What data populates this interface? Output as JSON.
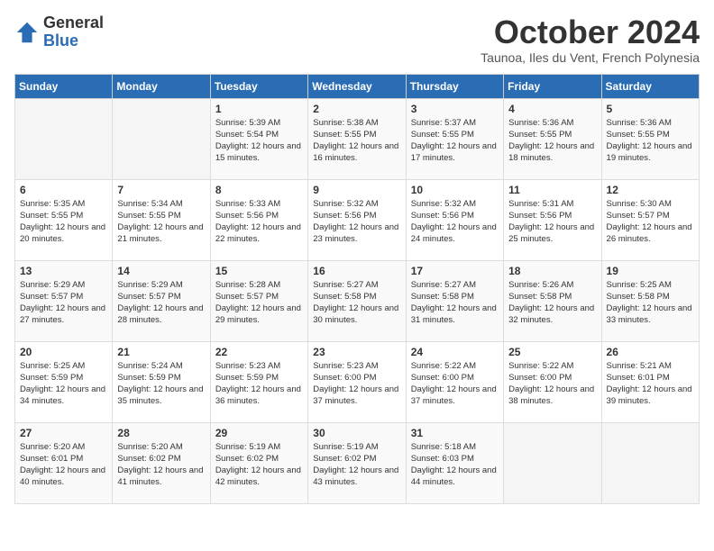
{
  "logo": {
    "general": "General",
    "blue": "Blue"
  },
  "header": {
    "month": "October 2024",
    "location": "Taunoa, Iles du Vent, French Polynesia"
  },
  "weekdays": [
    "Sunday",
    "Monday",
    "Tuesday",
    "Wednesday",
    "Thursday",
    "Friday",
    "Saturday"
  ],
  "weeks": [
    [
      {
        "day": "",
        "sunrise": "",
        "sunset": "",
        "daylight": ""
      },
      {
        "day": "",
        "sunrise": "",
        "sunset": "",
        "daylight": ""
      },
      {
        "day": "1",
        "sunrise": "Sunrise: 5:39 AM",
        "sunset": "Sunset: 5:54 PM",
        "daylight": "Daylight: 12 hours and 15 minutes."
      },
      {
        "day": "2",
        "sunrise": "Sunrise: 5:38 AM",
        "sunset": "Sunset: 5:55 PM",
        "daylight": "Daylight: 12 hours and 16 minutes."
      },
      {
        "day": "3",
        "sunrise": "Sunrise: 5:37 AM",
        "sunset": "Sunset: 5:55 PM",
        "daylight": "Daylight: 12 hours and 17 minutes."
      },
      {
        "day": "4",
        "sunrise": "Sunrise: 5:36 AM",
        "sunset": "Sunset: 5:55 PM",
        "daylight": "Daylight: 12 hours and 18 minutes."
      },
      {
        "day": "5",
        "sunrise": "Sunrise: 5:36 AM",
        "sunset": "Sunset: 5:55 PM",
        "daylight": "Daylight: 12 hours and 19 minutes."
      }
    ],
    [
      {
        "day": "6",
        "sunrise": "Sunrise: 5:35 AM",
        "sunset": "Sunset: 5:55 PM",
        "daylight": "Daylight: 12 hours and 20 minutes."
      },
      {
        "day": "7",
        "sunrise": "Sunrise: 5:34 AM",
        "sunset": "Sunset: 5:55 PM",
        "daylight": "Daylight: 12 hours and 21 minutes."
      },
      {
        "day": "8",
        "sunrise": "Sunrise: 5:33 AM",
        "sunset": "Sunset: 5:56 PM",
        "daylight": "Daylight: 12 hours and 22 minutes."
      },
      {
        "day": "9",
        "sunrise": "Sunrise: 5:32 AM",
        "sunset": "Sunset: 5:56 PM",
        "daylight": "Daylight: 12 hours and 23 minutes."
      },
      {
        "day": "10",
        "sunrise": "Sunrise: 5:32 AM",
        "sunset": "Sunset: 5:56 PM",
        "daylight": "Daylight: 12 hours and 24 minutes."
      },
      {
        "day": "11",
        "sunrise": "Sunrise: 5:31 AM",
        "sunset": "Sunset: 5:56 PM",
        "daylight": "Daylight: 12 hours and 25 minutes."
      },
      {
        "day": "12",
        "sunrise": "Sunrise: 5:30 AM",
        "sunset": "Sunset: 5:57 PM",
        "daylight": "Daylight: 12 hours and 26 minutes."
      }
    ],
    [
      {
        "day": "13",
        "sunrise": "Sunrise: 5:29 AM",
        "sunset": "Sunset: 5:57 PM",
        "daylight": "Daylight: 12 hours and 27 minutes."
      },
      {
        "day": "14",
        "sunrise": "Sunrise: 5:29 AM",
        "sunset": "Sunset: 5:57 PM",
        "daylight": "Daylight: 12 hours and 28 minutes."
      },
      {
        "day": "15",
        "sunrise": "Sunrise: 5:28 AM",
        "sunset": "Sunset: 5:57 PM",
        "daylight": "Daylight: 12 hours and 29 minutes."
      },
      {
        "day": "16",
        "sunrise": "Sunrise: 5:27 AM",
        "sunset": "Sunset: 5:58 PM",
        "daylight": "Daylight: 12 hours and 30 minutes."
      },
      {
        "day": "17",
        "sunrise": "Sunrise: 5:27 AM",
        "sunset": "Sunset: 5:58 PM",
        "daylight": "Daylight: 12 hours and 31 minutes."
      },
      {
        "day": "18",
        "sunrise": "Sunrise: 5:26 AM",
        "sunset": "Sunset: 5:58 PM",
        "daylight": "Daylight: 12 hours and 32 minutes."
      },
      {
        "day": "19",
        "sunrise": "Sunrise: 5:25 AM",
        "sunset": "Sunset: 5:58 PM",
        "daylight": "Daylight: 12 hours and 33 minutes."
      }
    ],
    [
      {
        "day": "20",
        "sunrise": "Sunrise: 5:25 AM",
        "sunset": "Sunset: 5:59 PM",
        "daylight": "Daylight: 12 hours and 34 minutes."
      },
      {
        "day": "21",
        "sunrise": "Sunrise: 5:24 AM",
        "sunset": "Sunset: 5:59 PM",
        "daylight": "Daylight: 12 hours and 35 minutes."
      },
      {
        "day": "22",
        "sunrise": "Sunrise: 5:23 AM",
        "sunset": "Sunset: 5:59 PM",
        "daylight": "Daylight: 12 hours and 36 minutes."
      },
      {
        "day": "23",
        "sunrise": "Sunrise: 5:23 AM",
        "sunset": "Sunset: 6:00 PM",
        "daylight": "Daylight: 12 hours and 37 minutes."
      },
      {
        "day": "24",
        "sunrise": "Sunrise: 5:22 AM",
        "sunset": "Sunset: 6:00 PM",
        "daylight": "Daylight: 12 hours and 37 minutes."
      },
      {
        "day": "25",
        "sunrise": "Sunrise: 5:22 AM",
        "sunset": "Sunset: 6:00 PM",
        "daylight": "Daylight: 12 hours and 38 minutes."
      },
      {
        "day": "26",
        "sunrise": "Sunrise: 5:21 AM",
        "sunset": "Sunset: 6:01 PM",
        "daylight": "Daylight: 12 hours and 39 minutes."
      }
    ],
    [
      {
        "day": "27",
        "sunrise": "Sunrise: 5:20 AM",
        "sunset": "Sunset: 6:01 PM",
        "daylight": "Daylight: 12 hours and 40 minutes."
      },
      {
        "day": "28",
        "sunrise": "Sunrise: 5:20 AM",
        "sunset": "Sunset: 6:02 PM",
        "daylight": "Daylight: 12 hours and 41 minutes."
      },
      {
        "day": "29",
        "sunrise": "Sunrise: 5:19 AM",
        "sunset": "Sunset: 6:02 PM",
        "daylight": "Daylight: 12 hours and 42 minutes."
      },
      {
        "day": "30",
        "sunrise": "Sunrise: 5:19 AM",
        "sunset": "Sunset: 6:02 PM",
        "daylight": "Daylight: 12 hours and 43 minutes."
      },
      {
        "day": "31",
        "sunrise": "Sunrise: 5:18 AM",
        "sunset": "Sunset: 6:03 PM",
        "daylight": "Daylight: 12 hours and 44 minutes."
      },
      {
        "day": "",
        "sunrise": "",
        "sunset": "",
        "daylight": ""
      },
      {
        "day": "",
        "sunrise": "",
        "sunset": "",
        "daylight": ""
      }
    ]
  ]
}
